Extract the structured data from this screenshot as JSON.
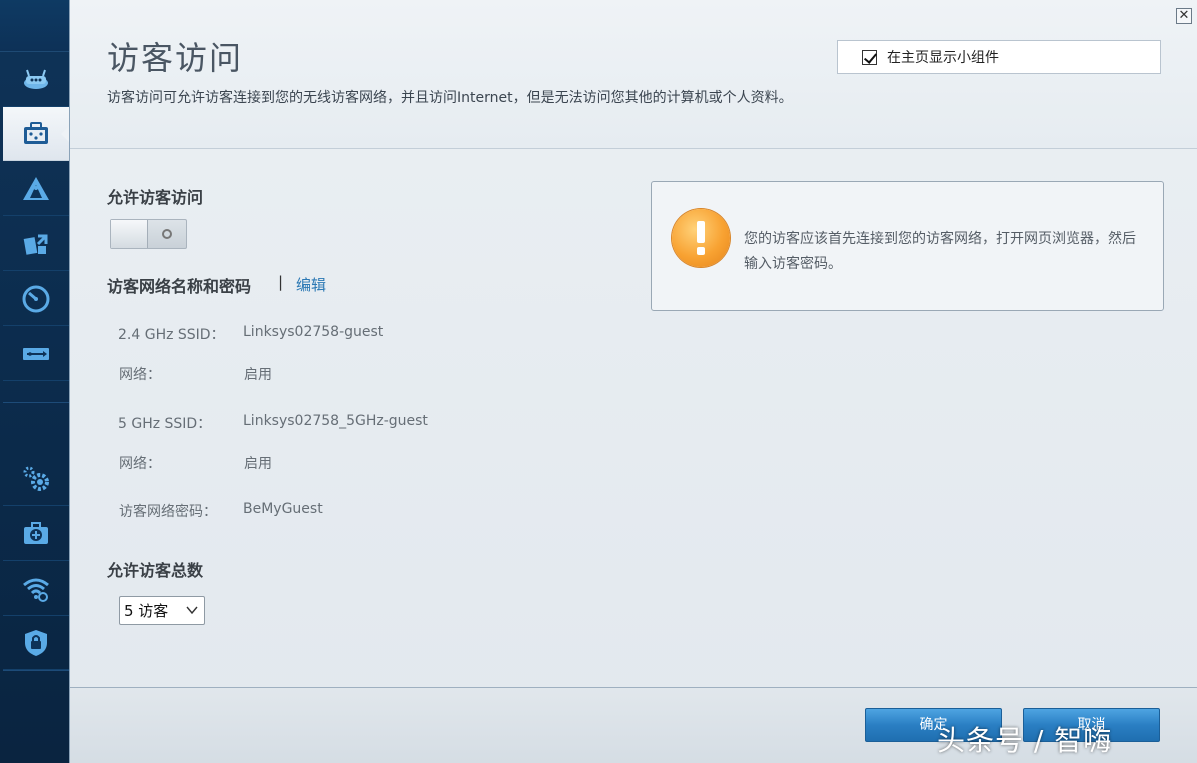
{
  "header": {
    "title": "访客访问",
    "description": "访客访问可允许访客连接到您的无线访客网络，并且访问Internet，但是无法访问您其他的计算机或个人资料。",
    "close_label": "✕",
    "widget_checkbox": {
      "label": "在主页显示小组件",
      "checked": true
    }
  },
  "sidebar": {
    "items": [
      {
        "icon": "router-icon"
      },
      {
        "icon": "guest-access-icon",
        "active": true
      },
      {
        "icon": "parental-controls-icon"
      },
      {
        "icon": "media-prioritization-icon"
      },
      {
        "icon": "speed-test-icon"
      },
      {
        "icon": "external-storage-icon"
      },
      {
        "icon": "connectivity-settings-icon"
      },
      {
        "icon": "troubleshooting-icon"
      },
      {
        "icon": "wireless-icon"
      },
      {
        "icon": "security-icon"
      }
    ]
  },
  "guest_access": {
    "allow_title": "允许访客访问",
    "toggle_on": false,
    "network_title": "访客网络名称和密码",
    "separator": "|",
    "edit_label": "编辑",
    "rows": [
      {
        "label": "2.4 GHz SSID：",
        "value": "Linksys02758-guest"
      },
      {
        "label": "网络：",
        "value": "启用"
      },
      {
        "label": "5 GHz SSID：",
        "value": "Linksys02758_5GHz-guest"
      },
      {
        "label": "网络：",
        "value": "启用"
      },
      {
        "label": "访客网络密码：",
        "value": "BeMyGuest"
      }
    ],
    "total_title": "允许访客总数",
    "total_select": "5 访客"
  },
  "notice": {
    "text": "您的访客应该首先连接到您的访客网络，打开网页浏览器，然后输入访客密码。"
  },
  "footer": {
    "ok_label": "确定",
    "cancel_label": "取消"
  },
  "watermark": "头条号 / 智嗨",
  "colors": {
    "accent": "#2b78b4",
    "button": "#2a7fc3",
    "warning": "#f8a232",
    "sidebar": "#0d2f52"
  }
}
